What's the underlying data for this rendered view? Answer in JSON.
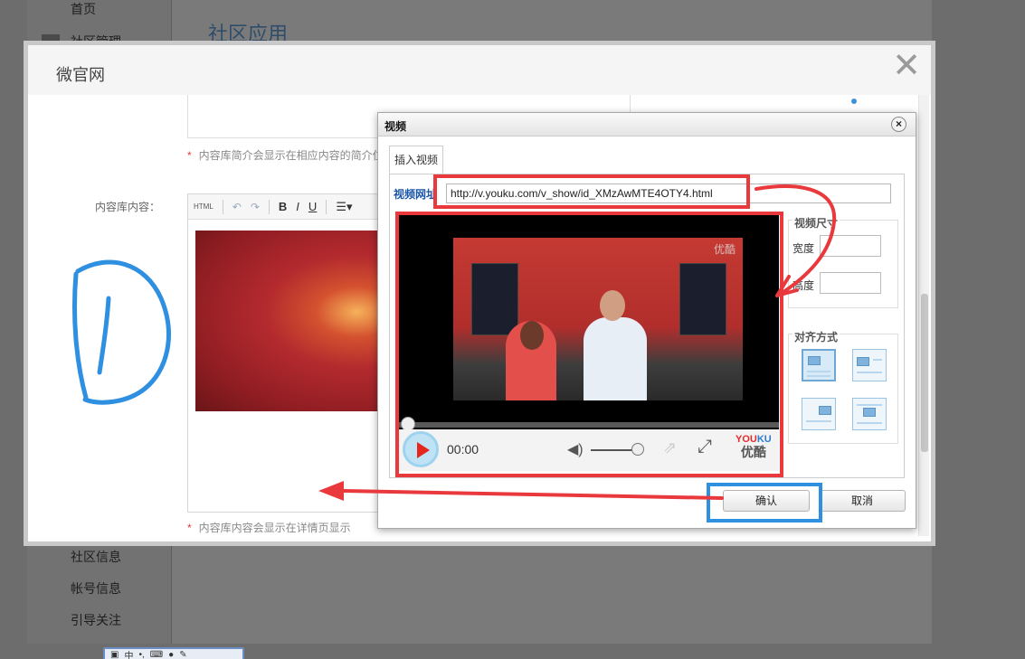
{
  "background": {
    "nav_top": "首页",
    "nav_community_mgmt": "社区管理",
    "page_title": "社区应用",
    "nav_items": [
      "社区信息",
      "帐号信息",
      "引导关注"
    ]
  },
  "dialog": {
    "title": "微官网",
    "close_symbol": "✕",
    "intro_hint": "内容库简介会显示在相应内容的简介位置",
    "content_label": "内容库内容：",
    "content_hint": "内容库内容会显示在详情页显示",
    "hint_star": "*",
    "toolbar": {
      "html_label": "HTML",
      "bold": "B",
      "italic": "I",
      "underline": "U",
      "list": "☰▾"
    }
  },
  "video_dialog": {
    "title": "视频",
    "close_symbol": "×",
    "tab_label": "插入视频",
    "url_label": "视频网址",
    "url_value": "http://v.youku.com/v_show/id_XMzAwMTE4OTY4.html",
    "size_group_title": "视频尺寸",
    "width_label": "宽度",
    "height_label": "高度",
    "align_group_title": "对齐方式",
    "confirm_label": "确认",
    "cancel_label": "取消",
    "player": {
      "time": "00:00",
      "brand_en_y": "YOU",
      "brand_en_k": "KU",
      "brand_cn": "优酷",
      "watermark": "优酷",
      "progress": 0.0,
      "volume": 0.8
    }
  },
  "colors": {
    "annotation_red": "#e9393d",
    "annotation_blue": "#2f8fe0",
    "link_blue": "#1a56a6"
  },
  "icons": {
    "dialog_close": "close-icon",
    "video_close": "close-circle-icon",
    "play": "play-icon",
    "volume": "volume-icon",
    "share": "share-icon",
    "fullscreen": "fullscreen-icon"
  }
}
